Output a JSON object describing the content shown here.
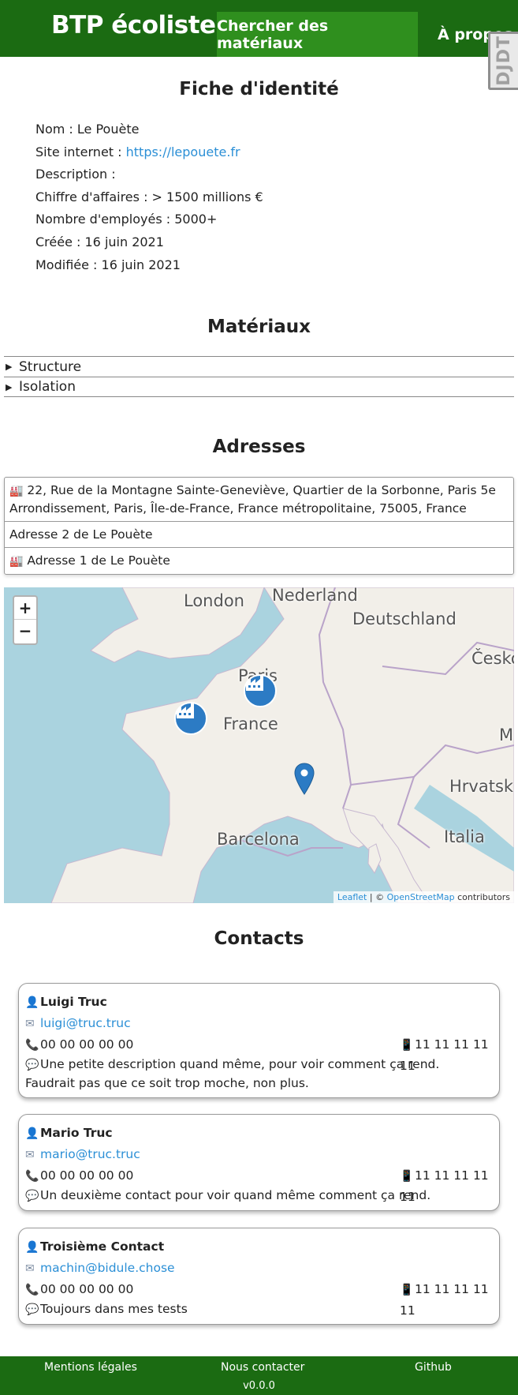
{
  "header": {
    "brand": "BTP écoliste",
    "nav_search": "Chercher des matériaux",
    "nav_about": "À propos",
    "debug_toolbar": "DJDT"
  },
  "identity": {
    "title": "Fiche d'identité",
    "name_label": "Nom : ",
    "name": "Le Pouète",
    "site_label": "Site internet : ",
    "site": "https://lepouete.fr",
    "description_label": "Description :",
    "turnover": "Chiffre d'affaires : > 1500 millions €",
    "employees": "Nombre d'employés : 5000+",
    "created": "Créée : 16 juin 2021",
    "modified": "Modifiée : 16 juin 2021"
  },
  "materials": {
    "title": "Matériaux",
    "items": [
      "Structure",
      "Isolation"
    ]
  },
  "addresses": {
    "title": "Adresses",
    "items": [
      "22, Rue de la Montagne Sainte-Geneviève, Quartier de la Sorbonne, Paris 5e Arrondissement, Paris, Île-de-France, France métropolitaine, 75005, France",
      "Adresse 2 de Le Pouète",
      "Adresse 1 de Le Pouète"
    ]
  },
  "map": {
    "zoom_in": "+",
    "zoom_out": "−",
    "labels": {
      "london": "London",
      "nederland": "Nederland",
      "deutschland": "Deutschland",
      "cesko": "Česko",
      "paris": "Paris",
      "france": "France",
      "barcelona": "Barcelona",
      "italia": "Italia",
      "hrvatska": "Hrvatsk",
      "m": "M"
    },
    "attribution_leaflet": "Leaflet",
    "attribution_sep": " | © ",
    "attribution_osm": "OpenStreetMap",
    "attribution_tail": " contributors",
    "colors": {
      "water": "#aad3df",
      "land": "#f2efe9",
      "marker": "#2c7bc4"
    }
  },
  "contacts": {
    "title": "Contacts",
    "items": [
      {
        "name": "Luigi Truc",
        "email": "luigi@truc.truc",
        "phone": "00 00 00 00 00",
        "mobile": "11 11 11 11 11",
        "description": "Une petite description quand même, pour voir comment ça rend. Faudrait pas que ce soit trop moche, non plus."
      },
      {
        "name": "Mario Truc",
        "email": "mario@truc.truc",
        "phone": "00 00 00 00 00",
        "mobile": "11 11 11 11 11",
        "description": "Un deuxième contact pour voir quand même comment ça rend."
      },
      {
        "name": "Troisième Contact",
        "email": "machin@bidule.chose",
        "phone": "00 00 00 00 00",
        "mobile": "11 11 11 11 11",
        "description": "Toujours dans mes tests"
      }
    ]
  },
  "footer": {
    "legal": "Mentions légales",
    "contact": "Nous contacter",
    "github": "Github",
    "version": "v0.0.0"
  },
  "theme": {
    "header_bg": "#1b6b12",
    "nav_active_bg": "#2f8f1e",
    "link": "#2b8fd6"
  }
}
